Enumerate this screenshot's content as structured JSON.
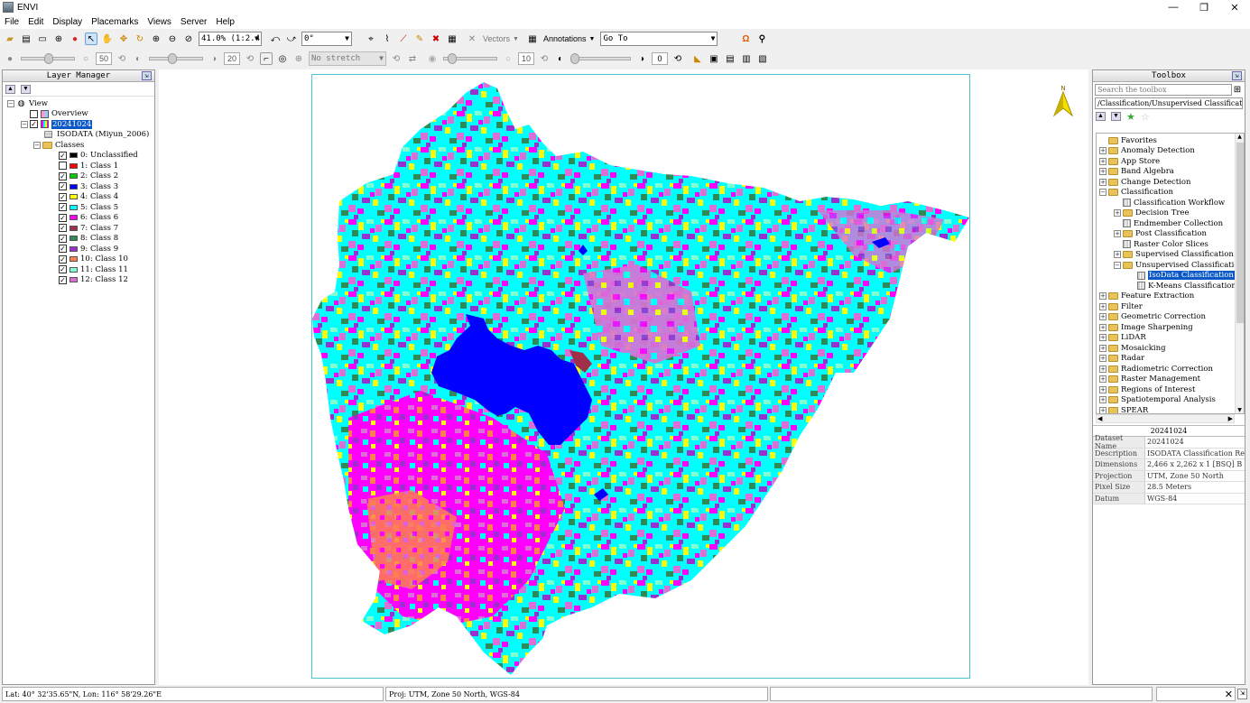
{
  "window": {
    "title": "ENVI",
    "minimize": "—",
    "maximize": "❐",
    "close": "✕"
  },
  "menu": [
    "File",
    "Edit",
    "Display",
    "Placemarks",
    "Views",
    "Server",
    "Help"
  ],
  "toolbar": {
    "zoom_value": "41.0% (1:2.4",
    "rotation_value": "0°",
    "vectors_label": "Vectors",
    "annotations_label": "Annotations",
    "goto_value": "Go To",
    "brightness_value": "50",
    "contrast_value": "20",
    "stretch_value": "No stretch",
    "sharpen_value": "10",
    "transparency_value": "0"
  },
  "layer_manager": {
    "title": "Layer Manager",
    "view_label": "View",
    "overview_label": "Overview",
    "raster_label": "20241024",
    "isodata_label": "ISODATA (Miyun_2006)",
    "classes_label": "Classes",
    "classes": [
      {
        "label": "0: Unclassified",
        "color": "#000000",
        "checked": true
      },
      {
        "label": "1: Class 1",
        "color": "#ff0000",
        "checked": false
      },
      {
        "label": "2: Class 2",
        "color": "#00cc00",
        "checked": true
      },
      {
        "label": "3: Class 3",
        "color": "#0000ff",
        "checked": true
      },
      {
        "label": "4: Class 4",
        "color": "#ffff00",
        "checked": true
      },
      {
        "label": "5: Class 5",
        "color": "#00ffff",
        "checked": true
      },
      {
        "label": "6: Class 6",
        "color": "#ff00ff",
        "checked": true
      },
      {
        "label": "7: Class 7",
        "color": "#a0304a",
        "checked": true
      },
      {
        "label": "8: Class 8",
        "color": "#2e8b57",
        "checked": true
      },
      {
        "label": "9: Class 9",
        "color": "#9b30d0",
        "checked": true
      },
      {
        "label": "10: Class 10",
        "color": "#ff7f50",
        "checked": true
      },
      {
        "label": "11: Class 11",
        "color": "#7fffd4",
        "checked": true
      },
      {
        "label": "12: Class 12",
        "color": "#da70d6",
        "checked": true
      }
    ]
  },
  "toolbox": {
    "title": "Toolbox",
    "search_placeholder": "Search the toolbox",
    "path": "/Classification/Unsupervised Classification",
    "tree": [
      {
        "label": "Favorites",
        "level": 0,
        "kind": "folder",
        "exp": ""
      },
      {
        "label": "Anomaly Detection",
        "level": 0,
        "kind": "folder",
        "exp": "+"
      },
      {
        "label": "App Store",
        "level": 0,
        "kind": "folder",
        "exp": "+"
      },
      {
        "label": "Band Algebra",
        "level": 0,
        "kind": "folder",
        "exp": "+"
      },
      {
        "label": "Change Detection",
        "level": 0,
        "kind": "folder",
        "exp": "+"
      },
      {
        "label": "Classification",
        "level": 0,
        "kind": "folder",
        "exp": "−"
      },
      {
        "label": "Classification Workflow",
        "level": 1,
        "kind": "tool",
        "exp": ""
      },
      {
        "label": "Decision Tree",
        "level": 1,
        "kind": "folder",
        "exp": "+"
      },
      {
        "label": "Endmember Collection",
        "level": 1,
        "kind": "tool",
        "exp": ""
      },
      {
        "label": "Post Classification",
        "level": 1,
        "kind": "folder",
        "exp": "+"
      },
      {
        "label": "Raster Color Slices",
        "level": 1,
        "kind": "tool",
        "exp": ""
      },
      {
        "label": "Supervised Classification",
        "level": 1,
        "kind": "folder",
        "exp": "+"
      },
      {
        "label": "Unsupervised Classification",
        "level": 1,
        "kind": "folder",
        "exp": "−"
      },
      {
        "label": "IsoData Classification",
        "level": 2,
        "kind": "tool",
        "exp": "",
        "selected": true
      },
      {
        "label": "K-Means Classification",
        "level": 2,
        "kind": "tool",
        "exp": ""
      },
      {
        "label": "Feature Extraction",
        "level": 0,
        "kind": "folder",
        "exp": "+"
      },
      {
        "label": "Filter",
        "level": 0,
        "kind": "folder",
        "exp": "+"
      },
      {
        "label": "Geometric Correction",
        "level": 0,
        "kind": "folder",
        "exp": "+"
      },
      {
        "label": "Image Sharpening",
        "level": 0,
        "kind": "folder",
        "exp": "+"
      },
      {
        "label": "LiDAR",
        "level": 0,
        "kind": "folder",
        "exp": "+"
      },
      {
        "label": "Mosaicking",
        "level": 0,
        "kind": "folder",
        "exp": "+"
      },
      {
        "label": "Radar",
        "level": 0,
        "kind": "folder",
        "exp": "+"
      },
      {
        "label": "Radiometric Correction",
        "level": 0,
        "kind": "folder",
        "exp": "+"
      },
      {
        "label": "Raster Management",
        "level": 0,
        "kind": "folder",
        "exp": "+"
      },
      {
        "label": "Regions of Interest",
        "level": 0,
        "kind": "folder",
        "exp": "+"
      },
      {
        "label": "Spatiotemporal Analysis",
        "level": 0,
        "kind": "folder",
        "exp": "+"
      },
      {
        "label": "SPEAR",
        "level": 0,
        "kind": "folder",
        "exp": "+"
      }
    ],
    "properties": {
      "title": "20241024",
      "rows": [
        {
          "key": "Dataset Name",
          "value": "20241024"
        },
        {
          "key": "Description",
          "value": "ISODATA Classification Re"
        },
        {
          "key": "Dimensions",
          "value": "2,466 x 2,262 x 1 [BSQ] B"
        },
        {
          "key": "Projection",
          "value": "UTM, Zone 50 North"
        },
        {
          "key": "Pixel Size",
          "value": "28.5 Meters"
        },
        {
          "key": "Datum",
          "value": "WGS-84"
        }
      ]
    }
  },
  "status": {
    "latlon": "Lat: 40° 32'35.65\"N, Lon: 116° 58'29.26\"E",
    "projection": "Proj: UTM, Zone 50 North, WGS-84"
  },
  "colors": {
    "accent_selected": "#0a58c8",
    "frame_border": "#4cc6d4",
    "class_palette": [
      "#00ffff",
      "#ff00ff",
      "#ffff00",
      "#7fffd4",
      "#da70d6",
      "#2e8b57",
      "#9b30d0",
      "#ff7f50"
    ]
  }
}
